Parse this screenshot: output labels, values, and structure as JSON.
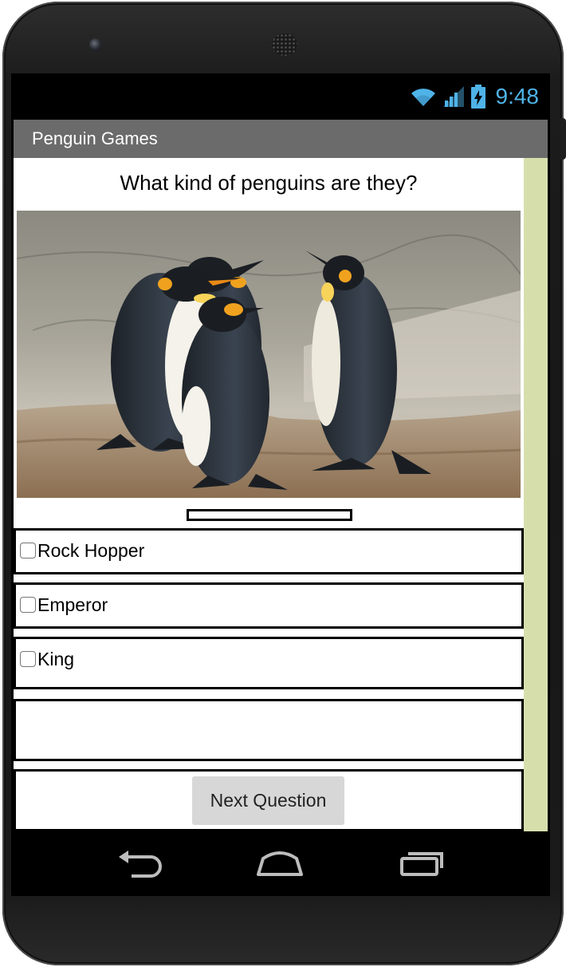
{
  "status_bar": {
    "time": "9:48",
    "wifi_icon": "wifi-icon",
    "signal_icon": "cell-signal-icon",
    "battery_icon": "battery-charging-icon",
    "icon_color": "#4fb3e8"
  },
  "app": {
    "title": "Penguin Games",
    "title_bar_color": "#6b6b6b"
  },
  "quiz": {
    "question": "What kind of penguins are they?",
    "image_subject": "king-penguins-photo",
    "progress": 0,
    "options": [
      {
        "label": "Rock Hopper",
        "checked": false
      },
      {
        "label": "Emperor",
        "checked": false
      },
      {
        "label": "King",
        "checked": false
      }
    ],
    "answer_feedback": "",
    "next_button_label": "Next Question"
  },
  "nav_bar": {
    "back_icon": "back-icon",
    "home_icon": "home-icon",
    "recents_icon": "recent-apps-icon"
  },
  "colors": {
    "scrollbar": "#d6dfac",
    "button": "#d7d7d7"
  }
}
